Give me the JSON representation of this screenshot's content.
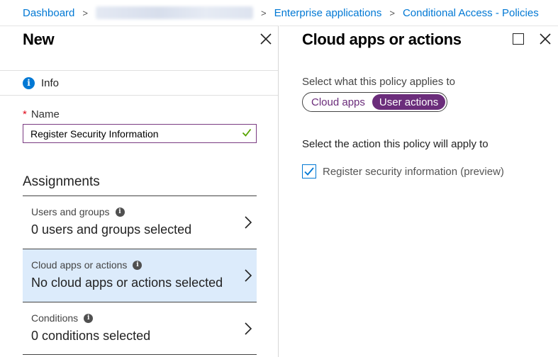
{
  "breadcrumb": {
    "items": [
      "Dashboard",
      "Enterprise applications",
      "Conditional Access - Policies"
    ]
  },
  "left_blade": {
    "title": "New",
    "info_label": "Info",
    "name_label": "Name",
    "required_mark": "*",
    "name_value": "Register Security Information",
    "assignments_heading": "Assignments",
    "assignments": [
      {
        "label": "Users and groups",
        "value": "0 users and groups selected"
      },
      {
        "label": "Cloud apps or actions",
        "value": "No cloud apps or actions selected"
      },
      {
        "label": "Conditions",
        "value": "0 conditions selected"
      }
    ]
  },
  "right_blade": {
    "title": "Cloud apps or actions",
    "applies_label": "Select what this policy applies to",
    "toggle_options": [
      "Cloud apps",
      "User actions"
    ],
    "selected_toggle": "User actions",
    "action_heading": "Select the action this policy will apply to",
    "checkbox_label": "Register security information (preview)",
    "checkbox_checked": true
  },
  "colors": {
    "link": "#0078d4",
    "accent_purple": "#6b2d7b",
    "selected_row": "#dcebfb",
    "valid_check": "#57a300",
    "required": "#e00b1c"
  },
  "icons": {
    "info": "info-circle-icon",
    "close": "close-icon",
    "maximize": "maximize-icon",
    "chevron": "chevron-right-icon",
    "valid": "checkmark-icon"
  }
}
